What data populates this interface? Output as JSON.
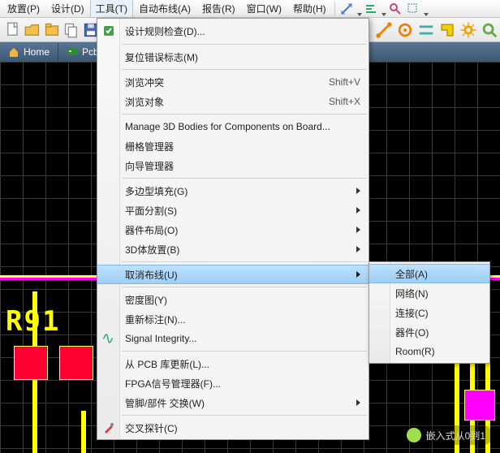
{
  "menubar": {
    "items": [
      {
        "label": "放置(P)",
        "hot": "P"
      },
      {
        "label": "设计(D)",
        "hot": "D"
      },
      {
        "label": "工具(T)",
        "hot": "T",
        "open": true
      },
      {
        "label": "自动布线(A)",
        "hot": "A"
      },
      {
        "label": "报告(R)",
        "hot": "R"
      },
      {
        "label": "窗口(W)",
        "hot": "W"
      },
      {
        "label": "帮助(H)",
        "hot": "H"
      }
    ]
  },
  "tabs": [
    {
      "label": "Home",
      "icon": "home-icon"
    },
    {
      "label": "PcbL",
      "icon": "pcb-icon"
    }
  ],
  "tools_menu": {
    "items": [
      {
        "label": "设计规则检查(D)...",
        "icon": "drc-icon"
      },
      {
        "sep": true
      },
      {
        "label": "复位错误标志(M)"
      },
      {
        "sep": true
      },
      {
        "label": "浏览冲突",
        "shortcut": "Shift+V"
      },
      {
        "label": "浏览对象",
        "shortcut": "Shift+X"
      },
      {
        "sep": true
      },
      {
        "label": "Manage 3D Bodies for Components on Board..."
      },
      {
        "label": "栅格管理器"
      },
      {
        "label": "向导管理器"
      },
      {
        "sep": true
      },
      {
        "label": "多边型填充(G)",
        "submenu": true
      },
      {
        "label": "平面分割(S)",
        "submenu": true
      },
      {
        "label": "器件布局(O)",
        "submenu": true
      },
      {
        "label": "3D体放置(B)",
        "submenu": true
      },
      {
        "sep": true
      },
      {
        "label": "取消布线(U)",
        "submenu": true,
        "highlight": true
      },
      {
        "sep": true
      },
      {
        "label": "密度图(Y)"
      },
      {
        "label": "重新标注(N)..."
      },
      {
        "label": "Signal Integrity...",
        "icon": "si-icon"
      },
      {
        "sep": true
      },
      {
        "label": "从 PCB 库更新(L)..."
      },
      {
        "label": "FPGA信号管理器(F)..."
      },
      {
        "label": "管脚/部件 交换(W)",
        "submenu": true
      },
      {
        "sep": true
      },
      {
        "label": "交叉探针(C)",
        "icon": "probe-icon"
      }
    ]
  },
  "unroute_submenu": {
    "items": [
      {
        "label": "全部(A)",
        "highlight": true
      },
      {
        "label": "网络(N)"
      },
      {
        "label": "连接(C)"
      },
      {
        "label": "器件(O)"
      },
      {
        "label": "Room(R)"
      }
    ]
  },
  "pcb": {
    "refdes": "R91"
  },
  "watermark": "嵌入式从0到1"
}
